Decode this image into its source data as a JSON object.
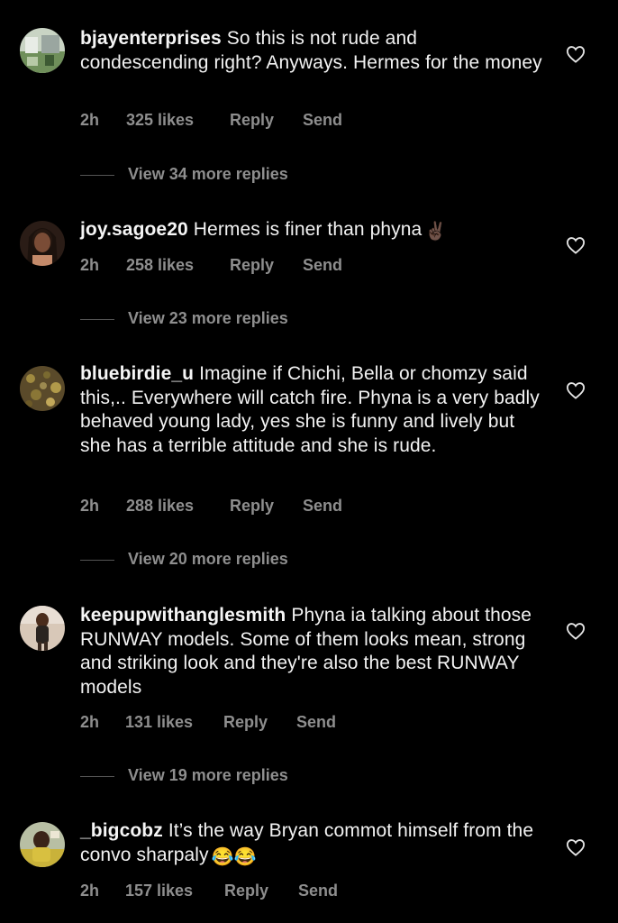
{
  "comments": [
    {
      "username": "bjayenterprises",
      "text": "So this is not rude and condescending right? Anyways. Hermes for the money",
      "emoji": "",
      "time": "2h",
      "likes": "325 likes",
      "reply_label": "Reply",
      "send_label": "Send",
      "view_replies": "View 34 more replies"
    },
    {
      "username": "joy.sagoe20",
      "text": "Hermes is finer than phyna",
      "emoji": "✌🏿",
      "time": "2h",
      "likes": "258 likes",
      "reply_label": "Reply",
      "send_label": "Send",
      "view_replies": "View 23 more replies"
    },
    {
      "username": "bluebirdie_u",
      "text": "Imagine if Chichi, Bella or chomzy said this,.. Everywhere will catch fire. Phyna is a very badly behaved young lady, yes she is funny and lively but she has a terrible attitude and she is rude.",
      "emoji": "",
      "time": "2h",
      "likes": "288 likes",
      "reply_label": "Reply",
      "send_label": "Send",
      "view_replies": "View 20 more replies"
    },
    {
      "username": "keepupwithanglesmith",
      "text": "Phyna ia talking about those RUNWAY models. Some of them looks mean, strong and striking look and they're also the best RUNWAY models",
      "emoji": "",
      "time": "2h",
      "likes": "131 likes",
      "reply_label": "Reply",
      "send_label": "Send",
      "view_replies": "View 19 more replies"
    },
    {
      "username": "_bigcobz",
      "text": "It’s the way Bryan commot himself from the convo sharpaly",
      "emoji": "😂😂",
      "time": "2h",
      "likes": "157 likes",
      "reply_label": "Reply",
      "send_label": "Send",
      "view_replies": ""
    }
  ]
}
